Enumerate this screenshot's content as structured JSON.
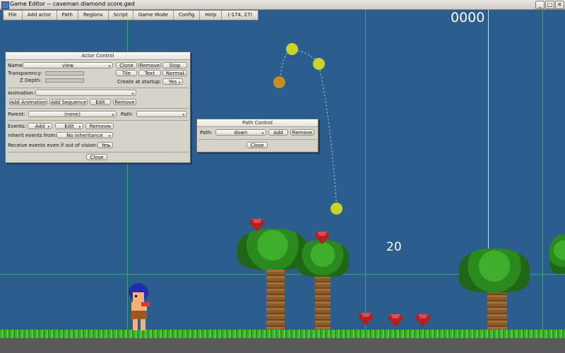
{
  "window": {
    "title": "Game Editor -- caveman diamond score.ged",
    "buttons": {
      "minimize": "_",
      "maximize": "□",
      "close": "✕"
    }
  },
  "menubar": {
    "items": [
      "File",
      "Add actor",
      "Path",
      "Regions",
      "Script",
      "Game Mode",
      "Config",
      "Help"
    ],
    "coords": "(-174, 27)"
  },
  "canvas": {
    "score_display": "0000",
    "counter_display": "20",
    "colors": {
      "background": "#2b5e8e",
      "grid": "#3aa37a",
      "path_ball_yellow": "#c7d42a",
      "path_ball_orange": "#c98d1a"
    }
  },
  "actor_control": {
    "title": "Actor Control",
    "name_label": "Name:",
    "name_value": "view",
    "clone": "Clone",
    "remove": "Remove",
    "stop": "Stop",
    "transparency_label": "Transparency:",
    "tile": "Tile",
    "text": "Text",
    "normal": "Normal",
    "zdepth_label": "Z Depth:",
    "create_label": "Create at startup:",
    "create_value": "Yes",
    "animation_label": "Animation:",
    "animation_value": "",
    "add_animation": "Add Animation",
    "add_sequence": "Add Sequence",
    "edit": "Edit",
    "remove2": "Remove",
    "parent_label": "Parent:",
    "parent_value": "(none)",
    "path_label": "Path:",
    "path_value": "",
    "events_label": "Events:",
    "events_add": "Add",
    "events_edit": "Edit",
    "events_remove": "Remove",
    "inherit_label": "Inherit events from:",
    "inherit_value": "No Inheritance",
    "receive_label": "Receive events even if out of vision:",
    "receive_value": "Yes",
    "close": "Close"
  },
  "path_control": {
    "title": "Path Control",
    "path_label": "Path:",
    "path_value": "down",
    "add": "Add",
    "remove": "Remove",
    "close": "Close"
  }
}
